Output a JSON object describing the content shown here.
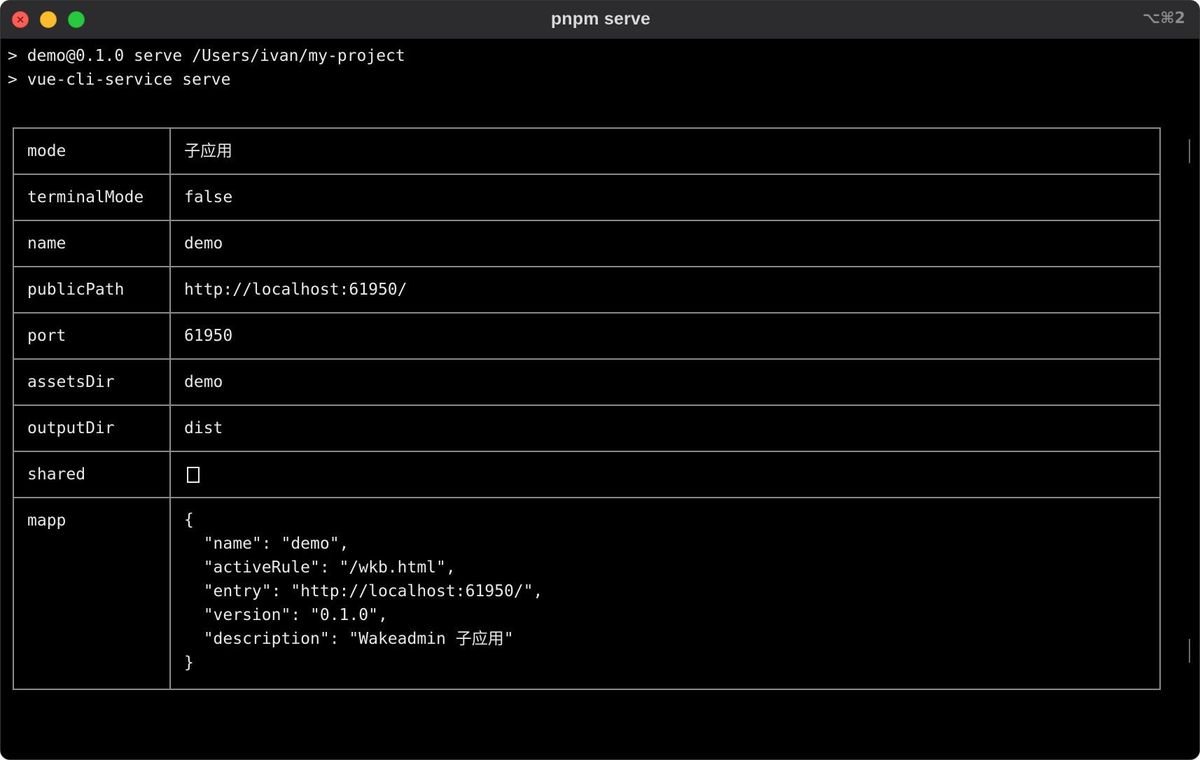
{
  "window": {
    "title": "pnpm serve",
    "shortcut": "⌥⌘2"
  },
  "terminal": {
    "lines": [
      "> demo@0.1.0 serve /Users/ivan/my-project",
      "> vue-cli-service serve"
    ]
  },
  "table": {
    "rows": [
      {
        "key": "mode",
        "value": "子应用"
      },
      {
        "key": "terminalMode",
        "value": "false"
      },
      {
        "key": "name",
        "value": "demo"
      },
      {
        "key": "publicPath",
        "value": "http://localhost:61950/"
      },
      {
        "key": "port",
        "value": "61950"
      },
      {
        "key": "assetsDir",
        "value": "demo"
      },
      {
        "key": "outputDir",
        "value": "dist"
      },
      {
        "key": "shared",
        "value": ""
      },
      {
        "key": "mapp",
        "value": "{\n  \"name\": \"demo\",\n  \"activeRule\": \"/wkb.html\",\n  \"entry\": \"http://localhost:61950/\",\n  \"version\": \"0.1.0\",\n  \"description\": \"Wakeadmin 子应用\"\n}"
      }
    ]
  },
  "colors": {
    "background": "#000000",
    "titlebar": "#2c2c2e",
    "text": "#e8e8e8",
    "table_border": "#8a8a8a",
    "close": "#ff5f57",
    "minimize": "#febc2e",
    "zoom": "#28c840"
  }
}
